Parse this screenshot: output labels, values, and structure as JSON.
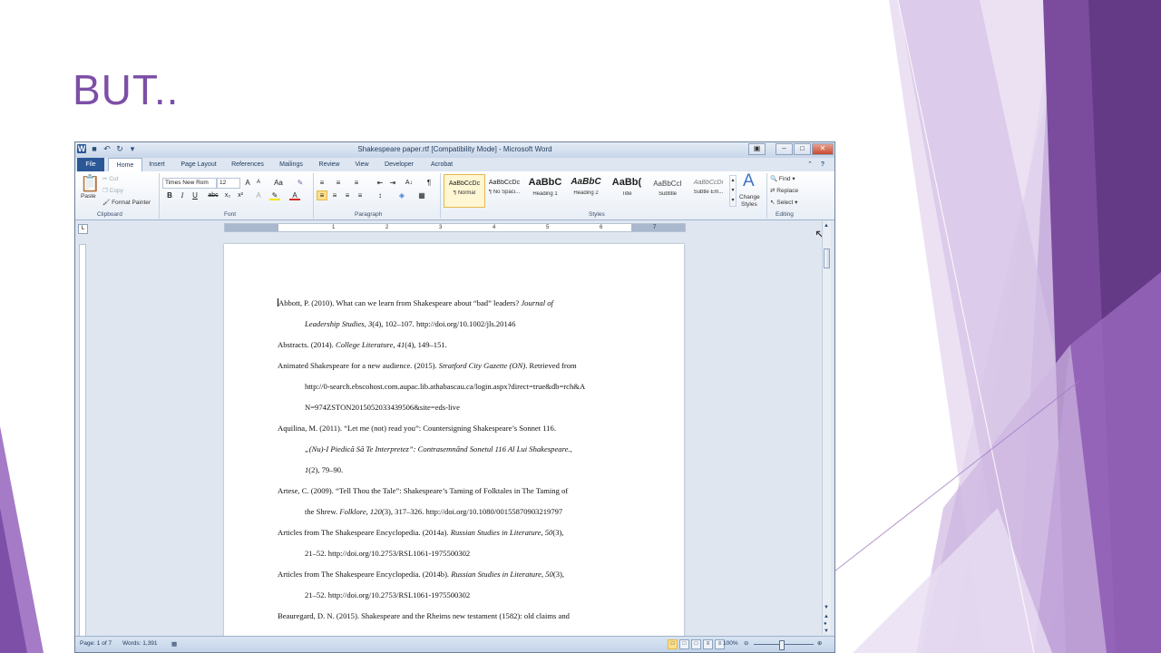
{
  "slide": {
    "title": "BUT..",
    "accent_color": "#7d4fa6"
  },
  "word": {
    "window_title": "Shakespeare paper.rtf [Compatibility Mode] - Microsoft Word",
    "tabs": [
      "File",
      "Home",
      "Insert",
      "Page Layout",
      "References",
      "Mailings",
      "Review",
      "View",
      "Developer",
      "Acrobat"
    ],
    "active_tab": "Home",
    "clipboard": {
      "paste": "Paste",
      "cut": "Cut",
      "copy": "Copy",
      "format_painter": "Format Painter",
      "label": "Clipboard"
    },
    "font": {
      "name": "Times New Rom",
      "size": "12",
      "label": "Font"
    },
    "paragraph": {
      "label": "Paragraph"
    },
    "styles": {
      "items": [
        {
          "preview": "AaBbCcDc",
          "name": "¶ Normal"
        },
        {
          "preview": "AaBbCcDc",
          "name": "¶ No Spaci..."
        },
        {
          "preview": "AaBbC",
          "name": "Heading 1"
        },
        {
          "preview": "AaBbC",
          "name": "Heading 2"
        },
        {
          "preview": "AaBb(",
          "name": "Title"
        },
        {
          "preview": "AaBbCcI",
          "name": "Subtitle"
        },
        {
          "preview": "AaBbCcDi",
          "name": "Subtle Em..."
        }
      ],
      "change_styles_1": "Change",
      "change_styles_2": "Styles",
      "label": "Styles"
    },
    "editing": {
      "find": "Find",
      "replace": "Replace",
      "select": "Select",
      "label": "Editing"
    },
    "ruler_numbers": [
      "1",
      "2",
      "3",
      "4",
      "5",
      "6",
      "7"
    ],
    "references": [
      {
        "lines": [
          [
            {
              "t": "Abbott, P. (2010). What can we learn from Shakespeare about “bad” leaders? "
            },
            {
              "t": "Journal of",
              "i": true
            }
          ],
          [
            {
              "t": "Leadership Studies, 3",
              "i": true
            },
            {
              "t": "(4), 102–107. http://doi.org/10.1002/jls.20146"
            }
          ]
        ]
      },
      {
        "lines": [
          [
            {
              "t": "Abstracts. (2014). "
            },
            {
              "t": "College Literature, 41",
              "i": true
            },
            {
              "t": "(4), 149–151."
            }
          ]
        ]
      },
      {
        "lines": [
          [
            {
              "t": "Animated Shakespeare for a new audience. (2015). "
            },
            {
              "t": "Stratford City Gazette (ON)",
              "i": true
            },
            {
              "t": ". Retrieved from"
            }
          ],
          [
            {
              "t": "http://0-search.ebscohost.com.aupac.lib.athabascau.ca/login.aspx?direct=true&db=rch&A"
            }
          ],
          [
            {
              "t": "N=974ZSTON2015052033439506&site=eds-live"
            }
          ]
        ]
      },
      {
        "lines": [
          [
            {
              "t": "Aquilina, M. (2011). “Let me (not) read you”: Countersigning Shakespeare’s Sonnet 116."
            }
          ],
          [
            {
              "t": "„(Nu)-I Piedică Să Te Interpretez”: Contrasemnând Sonetul 116 Al Lui Shakespeare.",
              "i": true
            },
            {
              "t": ","
            }
          ],
          [
            {
              "t": "1",
              "i": true
            },
            {
              "t": "(2), 79–90."
            }
          ]
        ]
      },
      {
        "lines": [
          [
            {
              "t": "Artese, C. (2009). “Tell Thou the Tale”: Shakespeare’s Taming of Folktales in The Taming of"
            }
          ],
          [
            {
              "t": "the Shrew. "
            },
            {
              "t": "Folklore, 120",
              "i": true
            },
            {
              "t": "(3), 317–326. http://doi.org/10.1080/00155870903219797"
            }
          ]
        ]
      },
      {
        "lines": [
          [
            {
              "t": "Articles from The Shakespeare Encyclopedia. (2014a). "
            },
            {
              "t": "Russian Studies in Literature, 50",
              "i": true
            },
            {
              "t": "(3),"
            }
          ],
          [
            {
              "t": "21–52. http://doi.org/10.2753/RSL1061-1975500302"
            }
          ]
        ]
      },
      {
        "lines": [
          [
            {
              "t": "Articles from The Shakespeare Encyclopedia. (2014b). "
            },
            {
              "t": "Russian Studies in Literature, 50",
              "i": true
            },
            {
              "t": "(3),"
            }
          ],
          [
            {
              "t": "21–52. http://doi.org/10.2753/RSL1061-1975500302"
            }
          ]
        ]
      },
      {
        "lines": [
          [
            {
              "t": "Beauregard, D. N. (2015). Shakespeare and the Rheims new testament (1582): old claims and"
            }
          ]
        ]
      }
    ],
    "status": {
      "page": "Page: 1 of 7",
      "words": "Words: 1,391",
      "zoom": "100%"
    }
  }
}
